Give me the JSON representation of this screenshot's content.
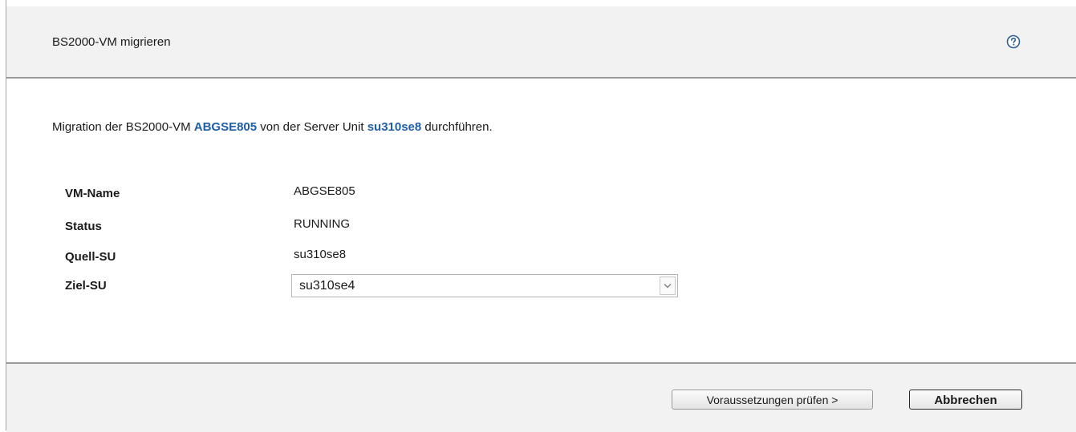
{
  "dialog": {
    "title": "BS2000-VM migrieren",
    "help_icon": "help-circle-icon"
  },
  "intro": {
    "prefix": "Migration der BS2000-VM ",
    "vm": "ABGSE805",
    "middle": " von der Server Unit ",
    "su": "su310se8",
    "suffix": " durchführen."
  },
  "fields": {
    "vm_name_label": "VM-Name",
    "vm_name_value": "ABGSE805",
    "status_label": "Status",
    "status_value": "RUNNING",
    "source_label": "Quell-SU",
    "source_value": "su310se8",
    "target_label": "Ziel-SU",
    "target_value": "su310se4"
  },
  "buttons": {
    "check_label": "Voraussetzungen prüfen >",
    "cancel_label": "Abbrechen"
  },
  "colors": {
    "highlight": "#1f5fa8",
    "header_bg": "#f2f2f2",
    "divider": "#9a9a9a"
  }
}
